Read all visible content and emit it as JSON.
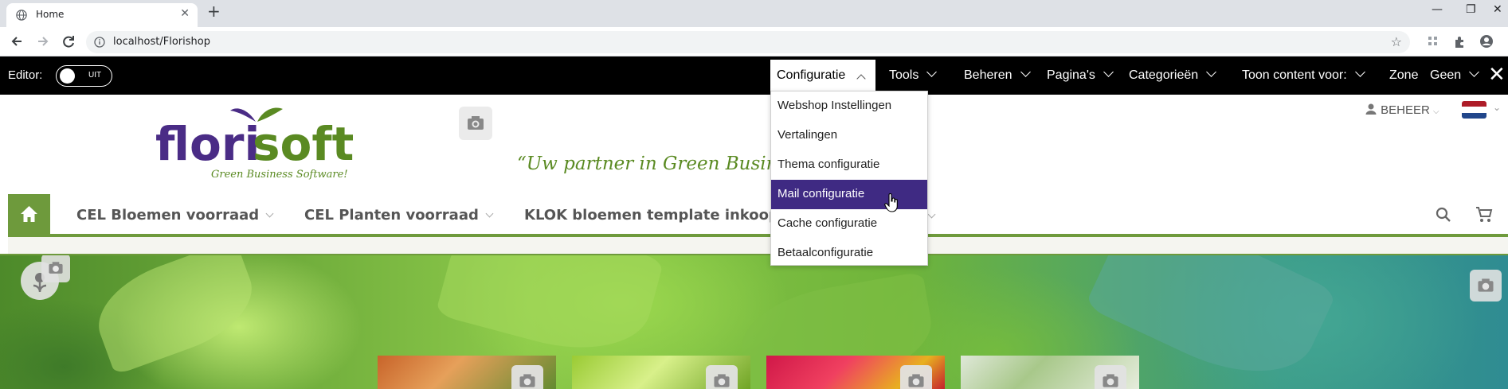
{
  "browser": {
    "tab_title": "Home",
    "url": "localhost/Florishop",
    "window_controls": [
      "minimize-icon",
      "restore-icon",
      "close-icon"
    ]
  },
  "editor_bar": {
    "editor_label": "Editor:",
    "toggle_label": "UIT",
    "menu": [
      {
        "label": "Configuratie",
        "open": true
      },
      {
        "label": "Tools"
      },
      {
        "label": "Beheren"
      },
      {
        "label": "Pagina's"
      },
      {
        "label": "Categorieën"
      },
      {
        "label": "Toon content voor:"
      },
      {
        "label": "Zone"
      },
      {
        "label": "Geen"
      }
    ],
    "dropdown": [
      {
        "label": "Webshop Instellingen"
      },
      {
        "label": "Vertalingen"
      },
      {
        "label": "Thema configuratie"
      },
      {
        "label": "Mail configuratie",
        "active": true
      },
      {
        "label": "Cache configuratie"
      },
      {
        "label": "Betaalconfiguratie"
      }
    ]
  },
  "site": {
    "logo_word_flori": "flori",
    "logo_word_soft": "soft",
    "logo_subtitle": "Green Business Software!",
    "tagline": "“Uw partner in Green Busin",
    "user_label": "BEHEER",
    "language_flag": "nl-flag",
    "nav": [
      {
        "label": "CEL Bloemen voorraad"
      },
      {
        "label": "CEL Planten voorraad"
      },
      {
        "label": "KLOK bloemen template inkoop"
      }
    ]
  },
  "colors": {
    "brand_green": "#6e9a3c",
    "brand_purple": "#3f2a83",
    "editor_bg": "#000000",
    "tagline_green": "#5a8a22"
  }
}
